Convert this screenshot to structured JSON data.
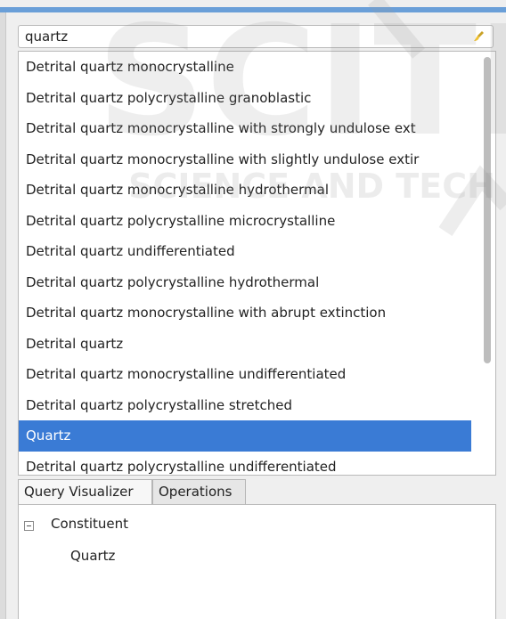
{
  "search": {
    "value": "quartz"
  },
  "results": [
    "Detrital quartz monocrystalline",
    "Detrital quartz polycrystalline granoblastic",
    "Detrital quartz monocrystalline with strongly undulose ext",
    "Detrital quartz monocrystalline with slightly undulose extir",
    "Detrital quartz monocrystalline hydrothermal",
    "Detrital quartz polycrystalline microcrystalline",
    "Detrital quartz undifferentiated",
    "Detrital quartz polycrystalline hydrothermal",
    "Detrital quartz monocrystalline with abrupt extinction",
    "Detrital quartz",
    "Detrital quartz monocrystalline undifferentiated",
    "Detrital quartz polycrystalline stretched",
    "Quartz",
    "Detrital quartz polycrystalline undifferentiated"
  ],
  "selected_index": 12,
  "tabs": [
    {
      "label": "Query Visualizer",
      "active": true
    },
    {
      "label": "Operations",
      "active": false
    }
  ],
  "tree": {
    "root": "Constituent",
    "child": "Quartz"
  },
  "watermark": {
    "line1": "SCITE",
    "line2": "SCIENCE AND TECH"
  },
  "colors": {
    "selection": "#3a7bd5",
    "top_accent": "#6a9fd8"
  }
}
